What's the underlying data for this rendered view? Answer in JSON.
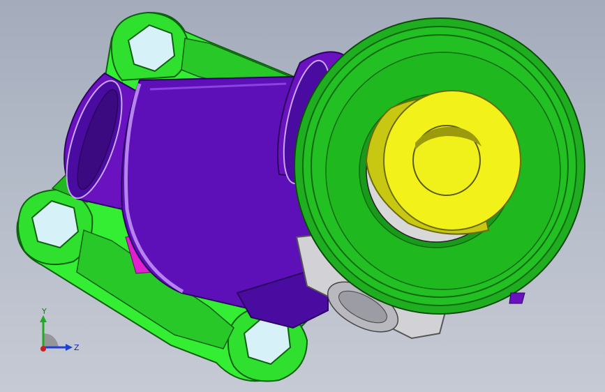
{
  "viewport": {
    "background_top": "#a4acbc",
    "background_bottom": "#c6cad4"
  },
  "model": {
    "colors": {
      "flange": "#33ee33",
      "flange_dark": "#1a9a1a",
      "bolt_hole": "#d6f2f8",
      "body": "#6a12c0",
      "body_dark": "#3c0a80",
      "body_light": "#9a52e8",
      "disc_outer": "#22c022",
      "disc_inner": "#1fb01f",
      "disc_rim": "#0f6a0f",
      "core": "#f2f21a",
      "core_dark": "#b8b80e",
      "gray_port": "#d2d2d6",
      "magenta": "#e01fcf"
    }
  },
  "triad": {
    "y_label": "Y",
    "z_label": "Z",
    "y_color": "#22aa22",
    "z_color": "#1f3fd8",
    "x_color": "#cc1f1f"
  }
}
